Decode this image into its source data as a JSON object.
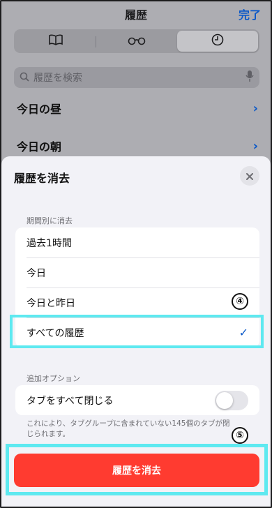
{
  "header": {
    "title": "履歴",
    "done_label": "完了"
  },
  "segments": [
    {
      "icon": "book-icon",
      "active": false
    },
    {
      "icon": "glasses-icon",
      "active": false
    },
    {
      "icon": "clock-icon",
      "active": true
    }
  ],
  "search": {
    "placeholder": "履歴を検索",
    "icon": "search-icon",
    "mic_icon": "microphone-icon"
  },
  "history_sections": [
    {
      "label": "今日の昼"
    },
    {
      "label": "今日の朝"
    }
  ],
  "sheet": {
    "title": "履歴を消去",
    "close_icon": "close-icon",
    "period_section_label": "期間別に消去",
    "period_options": [
      {
        "label": "過去1時間",
        "selected": false
      },
      {
        "label": "今日",
        "selected": false
      },
      {
        "label": "今日と昨日",
        "selected": false
      },
      {
        "label": "すべての履歴",
        "selected": true
      }
    ],
    "options_section_label": "追加オプション",
    "close_tabs_label": "タブをすべて閉じる",
    "close_tabs_enabled": false,
    "note": "これにより、タブグループに含まれていない145個のタブが閉じられます。",
    "clear_button_label": "履歴を消去"
  },
  "annotations": {
    "step4": "④",
    "step5": "⑤",
    "highlight_color": "#5ee9f0"
  }
}
